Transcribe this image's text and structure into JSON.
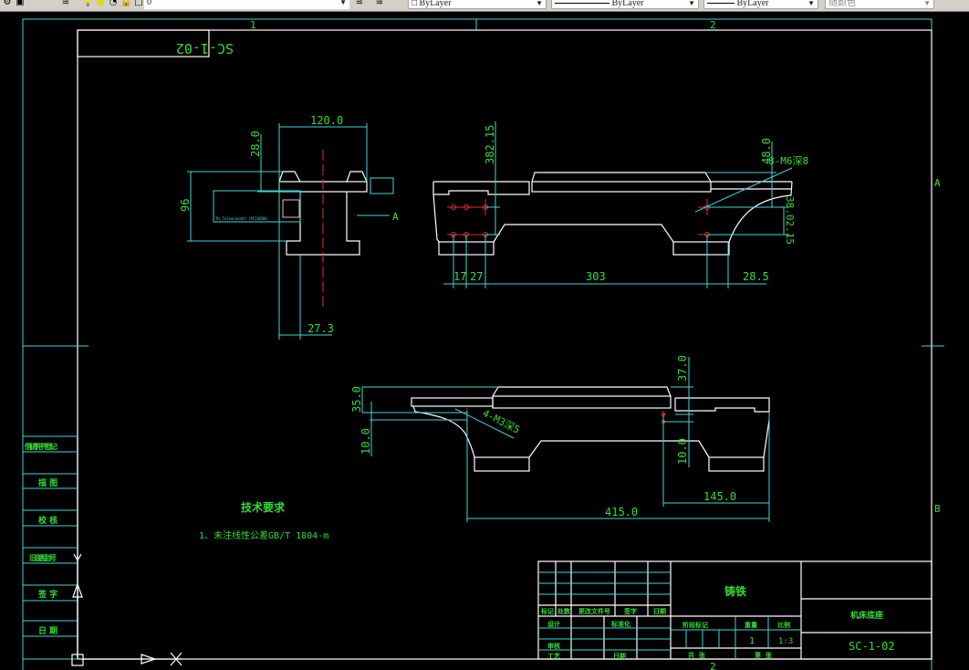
{
  "toolbar": {
    "layer_value": "0",
    "color_value": "ByLayer",
    "linetype_value": "ByLayer",
    "lineweight_value": "ByLayer",
    "plotstyle_value": "随颜色",
    "icons": [
      "layer-manager-icon",
      "layer-state-icon",
      "lightbulb-icon",
      "sun-icon",
      "lock-icon",
      "layer-color-icon",
      "make-current-icon",
      "layer-previous-icon"
    ]
  },
  "drawing": {
    "colors": {
      "background": "#000000",
      "geometry": "#ffffff",
      "dimension": "#3cd8d8",
      "text": "#33dd33",
      "centerline": "#e03030"
    },
    "mirrored_code": "SC-1-02",
    "zone_markers": {
      "col1": "1",
      "col2": "2",
      "rowA": "A",
      "rowB": "B",
      "bottom2": "2"
    },
    "side_view": {
      "dim_width": "120.0",
      "dim_height": "96",
      "dim_top": "28.0",
      "dim_bottom": "27.3",
      "view_arrow": "A",
      "block_label": "TH_Taleonnonht (PCIADDH)"
    },
    "front_view": {
      "dim_height": "382.15",
      "dim_17": "17",
      "dim_27": "27",
      "dim_303": "303",
      "dim_285": "28.5",
      "dim_48": "48.0",
      "dim_right": "38.02.15",
      "hole_note": "8-M6深8"
    },
    "bottom_view": {
      "dim_35": "35.0",
      "dim_10_left": "10.0",
      "dim_37": "37.0",
      "dim_10_right": "10.0",
      "dim_145": "145.0",
      "dim_415": "415.0",
      "hole_note": "4-M3深5"
    },
    "tech_req_title": "技术要求",
    "tech_req_1": "1、未注线性公差GB/T 1804-m"
  },
  "left_strip": [
    "借(通)用件登记",
    "描 图",
    "校 核",
    "旧底图总号",
    "签 字",
    "日 期"
  ],
  "title_block": {
    "material": "铸铁",
    "part_name": "机床底座",
    "drawing_no": "SC-1-02",
    "rev_headers": [
      "标记",
      "处数",
      "更改文件号",
      "签字",
      "日期"
    ],
    "design": "设计",
    "standardization": "标准化",
    "review": "审核",
    "process": "工艺",
    "date": "日期",
    "stage_mark": "阶段标记",
    "weight": "重量",
    "scale_label": "比例",
    "quantity": "1",
    "scale": "1:3",
    "total_sheets": "共  张",
    "sheet_no": "第  张"
  }
}
